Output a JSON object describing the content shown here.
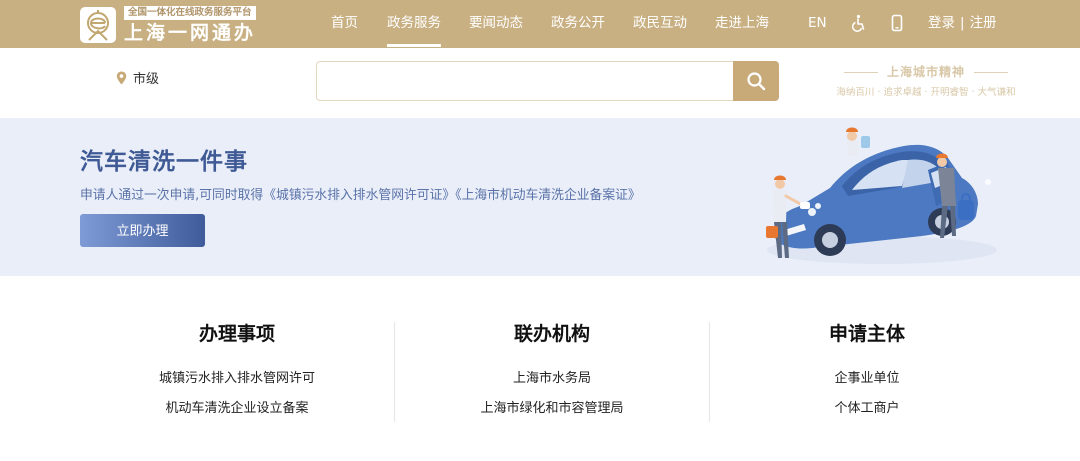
{
  "header": {
    "logo_tag": "全国一体化在线政务服务平台",
    "logo_title": "上海一网通办",
    "nav": [
      "首页",
      "政务服务",
      "要闻动态",
      "政务公开",
      "政民互动",
      "走进上海"
    ],
    "active_nav": "政务服务",
    "lang": "EN",
    "login": "登录",
    "divider": "|",
    "register": "注册"
  },
  "search": {
    "location": "市级",
    "placeholder": "",
    "value": ""
  },
  "city_spirit": {
    "title": "上海城市精神",
    "subtitle": "海纳百川 · 追求卓越 · 开明睿智 · 大气谦和"
  },
  "banner": {
    "title": "汽车清洗一件事",
    "description": "申请人通过一次申请,可同时取得《城镇污水排入排水管网许可证》《上海市机动车清洗企业备案证》",
    "button": "立即办理"
  },
  "columns": [
    {
      "heading": "办理事项",
      "items": [
        "城镇污水排入排水管网许可",
        "机动车清洗企业设立备案"
      ]
    },
    {
      "heading": "联办机构",
      "items": [
        "上海市水务局",
        "上海市绿化和市容管理局"
      ]
    },
    {
      "heading": "申请主体",
      "items": [
        "企事业单位",
        "个体工商户"
      ]
    }
  ],
  "icons": [
    "logo-e-icon",
    "accessibility-icon",
    "mobile-icon",
    "location-pin-icon",
    "search-icon",
    "car-wash-illustration"
  ],
  "colors": {
    "header_bg": "#c9b083",
    "banner_bg": "#e9eef9",
    "banner_text": "#3f5a95",
    "button": "#3f5b9a",
    "search_btn": "#c8aa79"
  }
}
